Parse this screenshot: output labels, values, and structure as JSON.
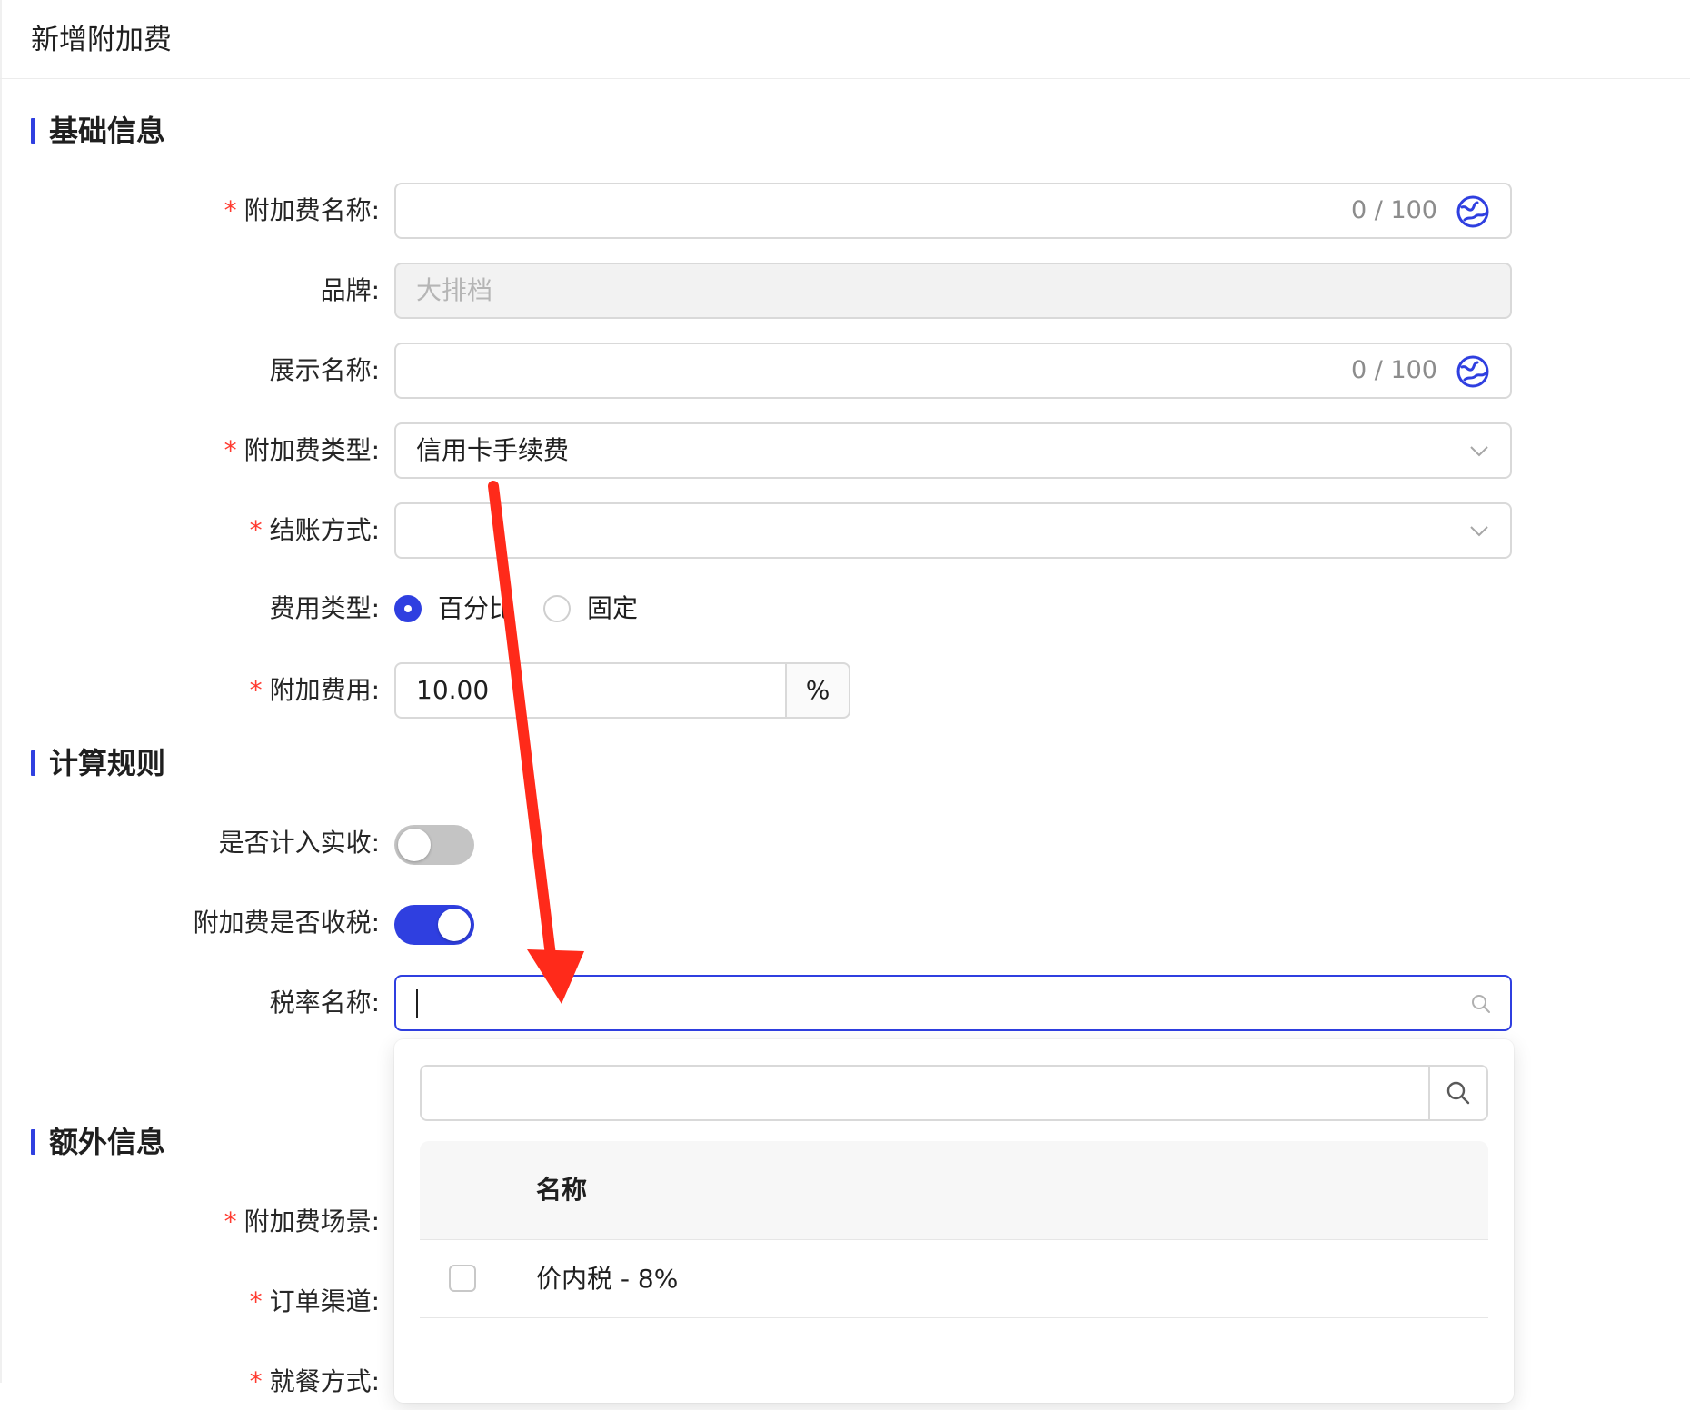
{
  "page": {
    "title": "新增附加费"
  },
  "sections": {
    "basic": "基础信息",
    "rules": "计算规则",
    "extra": "额外信息"
  },
  "form": {
    "surcharge_name": {
      "label": "附加费名称:",
      "value": "",
      "counter": "0 / 100"
    },
    "brand": {
      "label": "品牌:",
      "placeholder": "大排档"
    },
    "display_name": {
      "label": "展示名称:",
      "value": "",
      "counter": "0 / 100"
    },
    "surcharge_type": {
      "label": "附加费类型:",
      "value": "信用卡手续费"
    },
    "checkout_method": {
      "label": "结账方式:",
      "value": ""
    },
    "fee_type": {
      "label": "费用类型:",
      "options": [
        "百分比",
        "固定"
      ],
      "selected": "百分比"
    },
    "surcharge_fee": {
      "label": "附加费用:",
      "value": "10.00",
      "unit": "%"
    },
    "count_in_receipts": {
      "label": "是否计入实收:",
      "on": false
    },
    "taxable": {
      "label": "附加费是否收税:",
      "on": true
    },
    "tax_rate_name": {
      "label": "税率名称:",
      "value": ""
    },
    "scene": {
      "label": "附加费场景:"
    },
    "order_channel": {
      "label": "订单渠道:"
    },
    "dining_method": {
      "label": "就餐方式:"
    }
  },
  "dropdown": {
    "search_value": "",
    "column_header": "名称",
    "rows": [
      {
        "label": "价内税 - 8%",
        "checked": false
      }
    ]
  },
  "icons": [
    "globe-icon",
    "chevron-down-icon",
    "search-icon"
  ],
  "colors": {
    "accent": "#2f3fe0",
    "required": "#ff3b30",
    "annotation_arrow": "#ff2a1a"
  }
}
